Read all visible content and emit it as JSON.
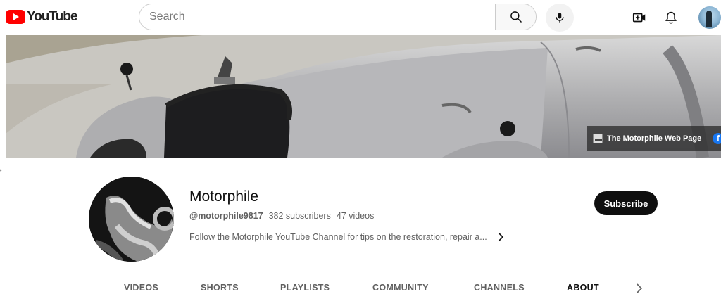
{
  "header": {
    "logo_text": "YouTube",
    "search_placeholder": "Search"
  },
  "banner": {
    "link_text": "The Motorphile Web Page",
    "fb_letter": "f"
  },
  "channel": {
    "name": "Motorphile",
    "handle": "@motorphile9817",
    "subscribers": "382 subscribers",
    "videos": "47 videos",
    "description": "Follow the Motorphile YouTube Channel for tips on the restoration, repair a...",
    "subscribe_label": "Subscribe"
  },
  "tabs": [
    {
      "label": "VIDEOS",
      "active": false
    },
    {
      "label": "SHORTS",
      "active": false
    },
    {
      "label": "PLAYLISTS",
      "active": false
    },
    {
      "label": "COMMUNITY",
      "active": false
    },
    {
      "label": "CHANNELS",
      "active": false
    },
    {
      "label": "ABOUT",
      "active": true
    }
  ],
  "icons": {
    "search": "search-icon",
    "mic": "mic-icon",
    "create": "create-video-icon",
    "notifications": "bell-icon",
    "next": "chevron-right-icon"
  },
  "colors": {
    "brand_red": "#ff0000",
    "subscribe_bg": "#0f0f0f",
    "secondary_text": "#606060"
  }
}
